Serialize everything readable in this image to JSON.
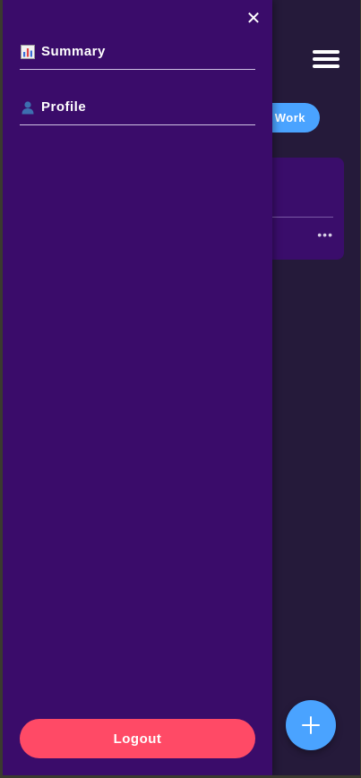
{
  "app": {
    "filter_chip_label": "Work"
  },
  "card": {
    "more_label": "•••"
  },
  "drawer": {
    "close_label": "✕",
    "items": [
      {
        "label": "Summary",
        "icon": "bar-chart-icon"
      },
      {
        "label": "Profile",
        "icon": "user-icon"
      }
    ],
    "logout_label": "Logout"
  },
  "colors": {
    "drawer_bg": "#3a0c6a",
    "app_bg": "#251a3a",
    "accent_blue": "#4aa3ff",
    "logout_red": "#ff4a66"
  }
}
